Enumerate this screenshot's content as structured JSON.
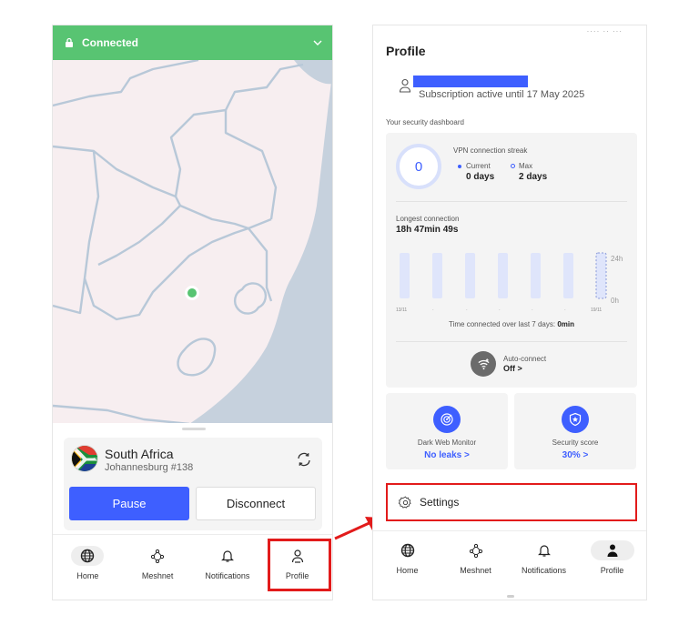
{
  "left_screen": {
    "status_bar": {
      "label": "Connected"
    },
    "location": {
      "country": "South Africa",
      "city": "Johannesburg #138"
    },
    "buttons": {
      "pause": "Pause",
      "disconnect": "Disconnect"
    },
    "nav": [
      {
        "label": "Home",
        "icon": "globe-icon"
      },
      {
        "label": "Meshnet",
        "icon": "meshnet-icon"
      },
      {
        "label": "Notifications",
        "icon": "bell-icon"
      },
      {
        "label": "Profile",
        "icon": "user-icon"
      }
    ],
    "highlighted_tab": "Profile"
  },
  "right_screen": {
    "title": "Profile",
    "subscription": "Subscription active until 17 May 2025",
    "dashboard_label": "Your security dashboard",
    "streak": {
      "value": "0",
      "title": "VPN connection streak",
      "current_label": "Current",
      "current_value": "0 days",
      "max_label": "Max",
      "max_value": "2 days"
    },
    "longest": {
      "label": "Longest connection",
      "value": "18h 47min 49s"
    },
    "weekly_chart": {
      "start_label": "13/11",
      "end_label": "19/11",
      "top_tick": "24h",
      "bottom_tick": "0h",
      "dots": [
        ".",
        ".",
        ".",
        ".",
        "."
      ],
      "caption_prefix": "Time connected over last 7 days: ",
      "caption_value": "0min",
      "hours": [
        0,
        0,
        0,
        0,
        0,
        0,
        0
      ]
    },
    "autoconnect": {
      "label": "Auto-connect",
      "value": "Off >"
    },
    "dark_web": {
      "label": "Dark Web Monitor",
      "value": "No leaks >"
    },
    "security_score": {
      "label": "Security score",
      "value": "30% >"
    },
    "settings": "Settings",
    "nav": [
      {
        "label": "Home",
        "icon": "globe-icon"
      },
      {
        "label": "Meshnet",
        "icon": "meshnet-icon"
      },
      {
        "label": "Notifications",
        "icon": "bell-icon"
      },
      {
        "label": "Profile",
        "icon": "user-filled-icon"
      }
    ]
  },
  "colors": {
    "connected_green": "#58c472",
    "accent_blue": "#3e5fff",
    "highlight_red": "#e21b1b",
    "map_land": "#f7eef0",
    "map_sea": "#c6d1dd"
  }
}
